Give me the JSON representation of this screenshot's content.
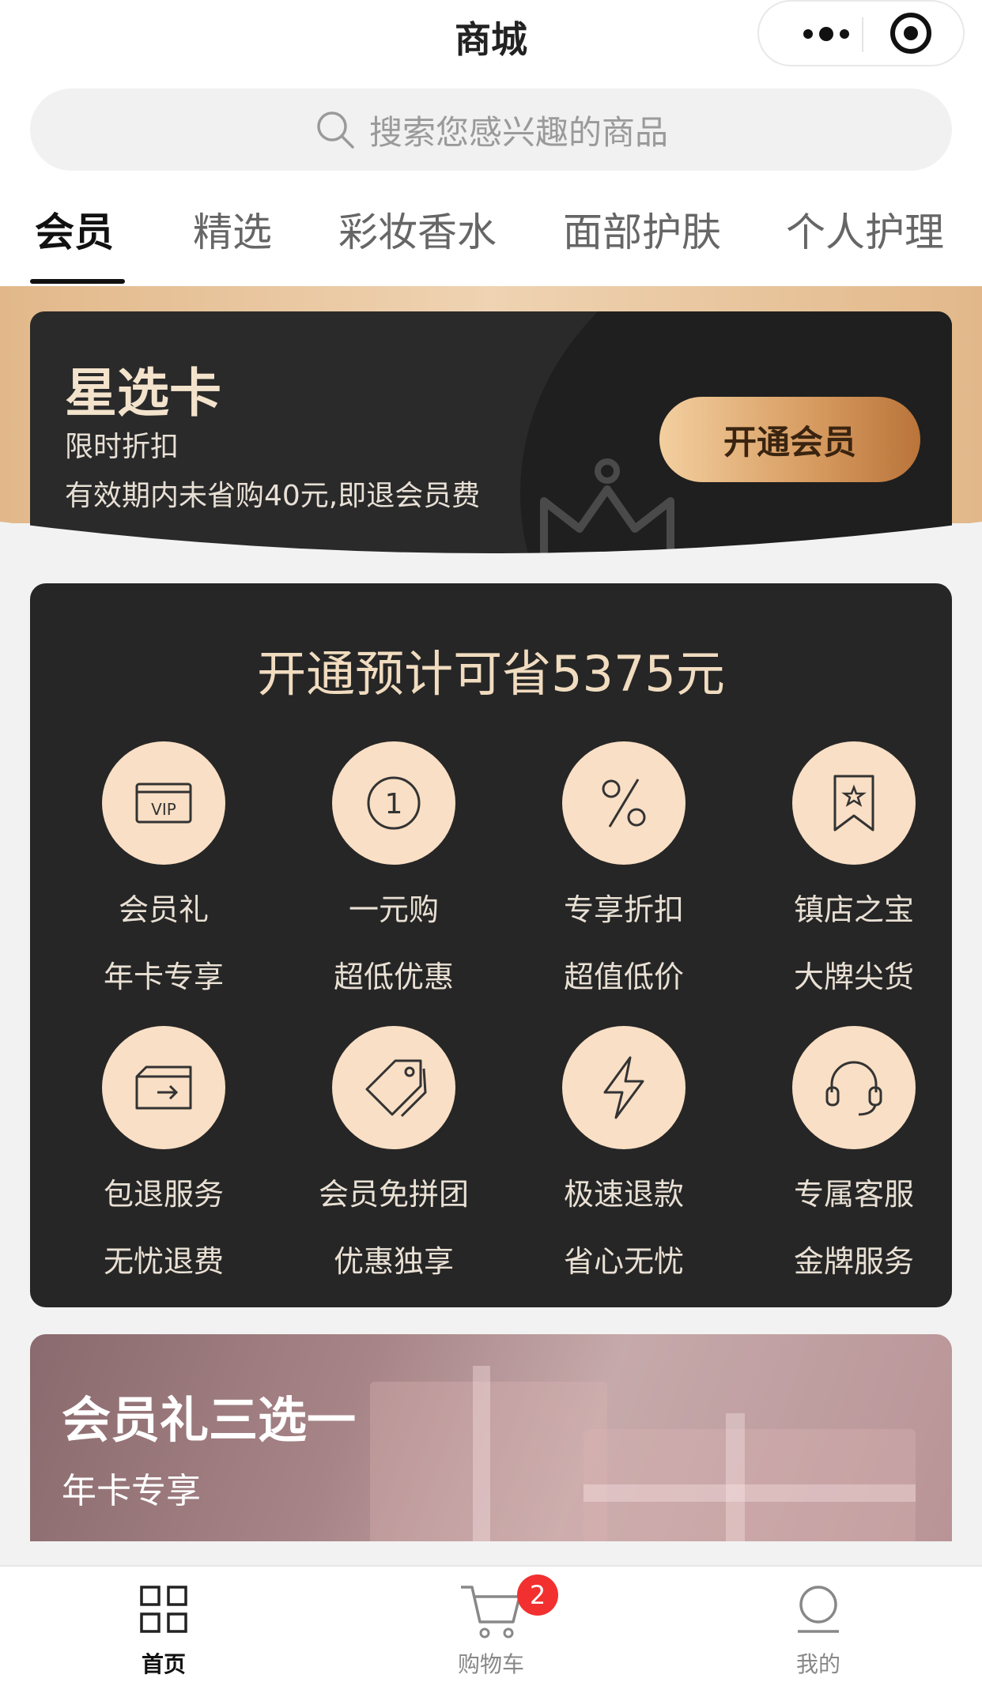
{
  "nav": {
    "title": "商城"
  },
  "search": {
    "placeholder": "搜索您感兴趣的商品"
  },
  "tabs": [
    {
      "label": "会员",
      "active": true
    },
    {
      "label": "精选"
    },
    {
      "label": "彩妆香水"
    },
    {
      "label": "面部护肤"
    },
    {
      "label": "个人护理"
    }
  ],
  "star_card": {
    "title": "星选卡",
    "subtitle": "限时折扣",
    "desc": "有效期内未省购40元,即退会员费",
    "button": "开通会员"
  },
  "benefits": {
    "title": "开通预计可省5375元",
    "items": [
      {
        "icon": "vip-card-icon",
        "l1": "会员礼",
        "l2": "年卡专享"
      },
      {
        "icon": "one-yuan-icon",
        "l1": "一元购",
        "l2": "超低优惠"
      },
      {
        "icon": "percent-icon",
        "l1": "专享折扣",
        "l2": "超值低价"
      },
      {
        "icon": "bookmark-star-icon",
        "l1": "镇店之宝",
        "l2": "大牌尖货"
      },
      {
        "icon": "return-box-icon",
        "l1": "包退服务",
        "l2": "无忧退费"
      },
      {
        "icon": "price-tag-icon",
        "l1": "会员免拼团",
        "l2": "优惠独享"
      },
      {
        "icon": "lightning-icon",
        "l1": "极速退款",
        "l2": "省心无忧"
      },
      {
        "icon": "headset-icon",
        "l1": "专属客服",
        "l2": "金牌服务"
      }
    ]
  },
  "gift_banner": {
    "title": "会员礼三选一",
    "subtitle": "年卡专享"
  },
  "tabbar": {
    "items": [
      {
        "label": "首页",
        "icon": "grid-icon",
        "active": true
      },
      {
        "label": "购物车",
        "icon": "cart-icon",
        "badge": "2"
      },
      {
        "label": "我的",
        "icon": "profile-icon"
      }
    ]
  },
  "colors": {
    "gold": "#f9dfc5",
    "dark_card": "#262626",
    "badge_red": "#f23030"
  }
}
